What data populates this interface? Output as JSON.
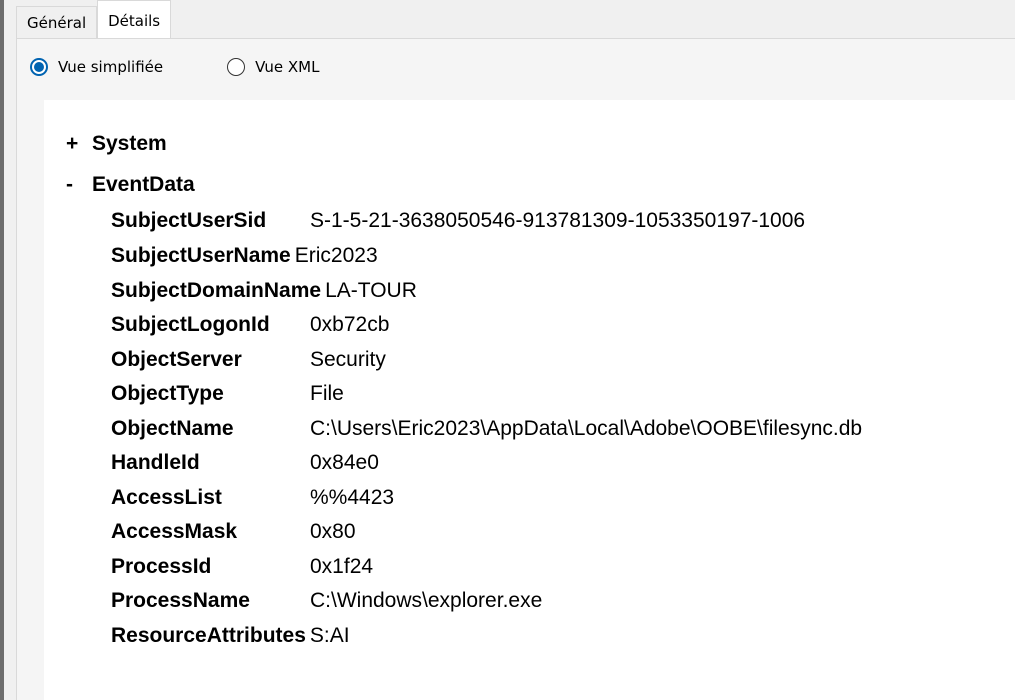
{
  "tabs": [
    {
      "label": "Général",
      "active": false
    },
    {
      "label": "Détails",
      "active": true
    }
  ],
  "view_modes": {
    "simplified": {
      "label": "Vue simplifiée",
      "selected": true
    },
    "xml": {
      "label": "Vue XML",
      "selected": false
    }
  },
  "tree": {
    "system": {
      "toggle": "+",
      "label": "System"
    },
    "event_data": {
      "toggle": "-",
      "label": "EventData"
    }
  },
  "event_data": [
    {
      "key": "SubjectUserSid",
      "value": "S-1-5-21-3638050546-913781309-1053350197-1006"
    },
    {
      "key": "SubjectUserName",
      "value": "Eric2023"
    },
    {
      "key": "SubjectDomainName",
      "value": "LA-TOUR"
    },
    {
      "key": "SubjectLogonId",
      "value": "0xb72cb"
    },
    {
      "key": "ObjectServer",
      "value": "Security"
    },
    {
      "key": "ObjectType",
      "value": "File"
    },
    {
      "key": "ObjectName",
      "value": "C:\\Users\\Eric2023\\AppData\\Local\\Adobe\\OOBE\\filesync.db"
    },
    {
      "key": "HandleId",
      "value": "0x84e0"
    },
    {
      "key": "AccessList",
      "value": "%%4423"
    },
    {
      "key": "AccessMask",
      "value": "0x80"
    },
    {
      "key": "ProcessId",
      "value": "0x1f24"
    },
    {
      "key": "ProcessName",
      "value": "C:\\Windows\\explorer.exe"
    },
    {
      "key": "ResourceAttributes",
      "value": "S:AI"
    }
  ]
}
